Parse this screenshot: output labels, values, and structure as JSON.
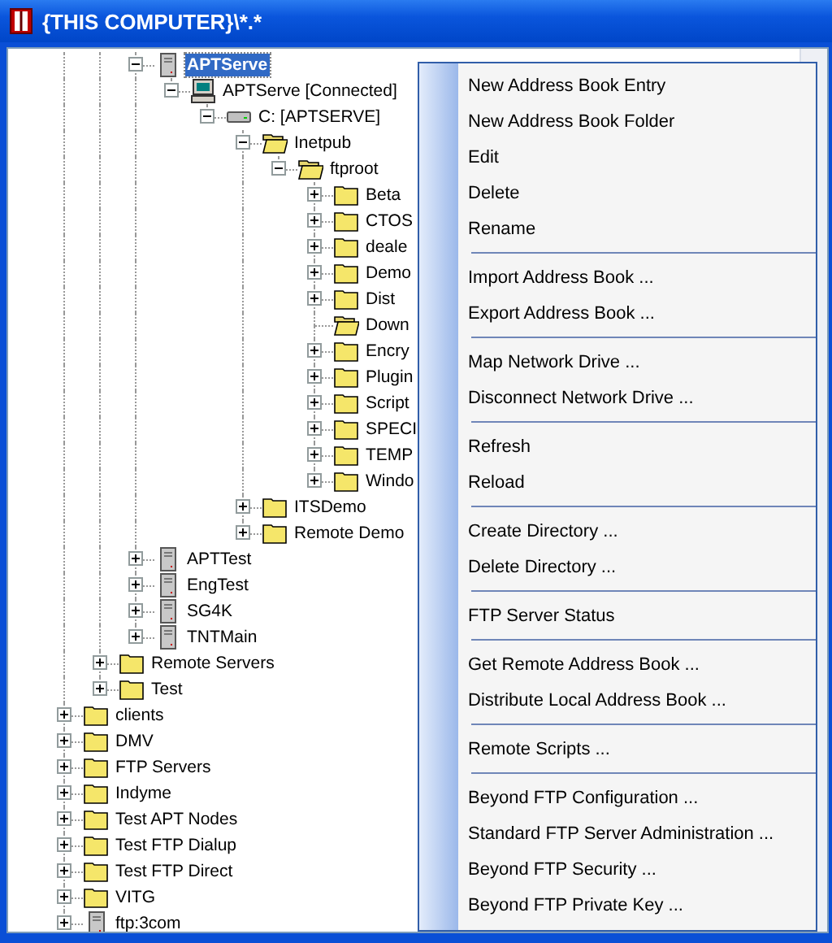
{
  "window": {
    "title": "{THIS COMPUTER}\\*.*"
  },
  "tree": {
    "children": [
      {
        "children": [
          {
            "children": [
              {
                "label": "APTServe",
                "kind": "server",
                "expandable": true,
                "expanded": true,
                "selected": true,
                "children": [
                  {
                    "label": "APTServe [Connected]",
                    "kind": "computer",
                    "expandable": true,
                    "expanded": true,
                    "selected": false,
                    "children": [
                      {
                        "label": "C: [APTSERVE]",
                        "kind": "drive",
                        "expandable": true,
                        "expanded": true,
                        "selected": false,
                        "children": [
                          {
                            "label": "Inetpub",
                            "kind": "folder",
                            "expandable": true,
                            "expanded": true,
                            "selected": false,
                            "children": [
                              {
                                "label": "ftproot",
                                "kind": "folder",
                                "expandable": true,
                                "expanded": true,
                                "selected": false,
                                "children": [
                                  {
                                    "label": "Beta",
                                    "kind": "folder",
                                    "expandable": true,
                                    "expanded": false,
                                    "selected": false
                                  },
                                  {
                                    "label": "CTOS",
                                    "kind": "folder",
                                    "expandable": true,
                                    "expanded": false,
                                    "selected": false
                                  },
                                  {
                                    "label": "deale",
                                    "kind": "folder",
                                    "expandable": true,
                                    "expanded": false,
                                    "selected": false
                                  },
                                  {
                                    "label": "Demo",
                                    "kind": "folder",
                                    "expandable": true,
                                    "expanded": false,
                                    "selected": false
                                  },
                                  {
                                    "label": "Dist",
                                    "kind": "folder",
                                    "expandable": true,
                                    "expanded": false,
                                    "selected": false
                                  },
                                  {
                                    "label": "Down",
                                    "kind": "open_folder",
                                    "expandable": false,
                                    "selected": false
                                  },
                                  {
                                    "label": "Encry",
                                    "kind": "folder",
                                    "expandable": true,
                                    "expanded": false,
                                    "selected": false
                                  },
                                  {
                                    "label": "Plugin",
                                    "kind": "folder",
                                    "expandable": true,
                                    "expanded": false,
                                    "selected": false
                                  },
                                  {
                                    "label": "Script",
                                    "kind": "folder",
                                    "expandable": true,
                                    "expanded": false,
                                    "selected": false
                                  },
                                  {
                                    "label": "SPECI",
                                    "kind": "folder",
                                    "expandable": true,
                                    "expanded": false,
                                    "selected": false
                                  },
                                  {
                                    "label": "TEMP",
                                    "kind": "folder",
                                    "expandable": true,
                                    "expanded": false,
                                    "selected": false
                                  },
                                  {
                                    "label": "Windo",
                                    "kind": "folder",
                                    "expandable": true,
                                    "expanded": false,
                                    "selected": false
                                  }
                                ]
                              }
                            ]
                          },
                          {
                            "label": "ITSDemo",
                            "kind": "folder",
                            "expandable": true,
                            "expanded": false,
                            "selected": false
                          },
                          {
                            "label": "Remote Demo",
                            "kind": "folder",
                            "expandable": true,
                            "expanded": false,
                            "selected": false
                          }
                        ]
                      }
                    ]
                  }
                ]
              },
              {
                "label": "APTTest",
                "kind": "server",
                "expandable": true,
                "expanded": false,
                "selected": false
              },
              {
                "label": "EngTest",
                "kind": "server",
                "expandable": true,
                "expanded": false,
                "selected": false
              },
              {
                "label": "SG4K",
                "kind": "server",
                "expandable": true,
                "expanded": false,
                "selected": false
              },
              {
                "label": "TNTMain",
                "kind": "server",
                "expandable": true,
                "expanded": false,
                "selected": false
              }
            ]
          },
          {
            "label": "Remote Servers",
            "kind": "folder",
            "expandable": true,
            "expanded": false,
            "selected": false
          },
          {
            "label": "Test",
            "kind": "folder",
            "expandable": true,
            "expanded": false,
            "selected": false
          }
        ]
      },
      {
        "label": "clients",
        "kind": "folder",
        "expandable": true,
        "expanded": false,
        "selected": false
      },
      {
        "label": "DMV",
        "kind": "folder",
        "expandable": true,
        "expanded": false,
        "selected": false
      },
      {
        "label": "FTP Servers",
        "kind": "folder",
        "expandable": true,
        "expanded": false,
        "selected": false
      },
      {
        "label": "Indyme",
        "kind": "folder",
        "expandable": true,
        "expanded": false,
        "selected": false
      },
      {
        "label": "Test APT Nodes",
        "kind": "folder",
        "expandable": true,
        "expanded": false,
        "selected": false
      },
      {
        "label": "Test FTP Dialup",
        "kind": "folder",
        "expandable": true,
        "expanded": false,
        "selected": false
      },
      {
        "label": "Test FTP Direct",
        "kind": "folder",
        "expandable": true,
        "expanded": false,
        "selected": false
      },
      {
        "label": "VITG",
        "kind": "folder",
        "expandable": true,
        "expanded": false,
        "selected": false
      },
      {
        "label": "ftp:3com",
        "kind": "server",
        "expandable": true,
        "expanded": false,
        "selected": false
      }
    ]
  },
  "context_menu": {
    "groups": [
      {
        "items": [
          {
            "label": "New Address Book Entry"
          },
          {
            "label": "New Address Book Folder"
          },
          {
            "label": "Edit"
          },
          {
            "label": "Delete"
          },
          {
            "label": "Rename"
          }
        ]
      },
      {
        "items": [
          {
            "label": "Import Address Book ..."
          },
          {
            "label": "Export Address Book ..."
          }
        ]
      },
      {
        "items": [
          {
            "label": "Map Network Drive ..."
          },
          {
            "label": "Disconnect Network Drive ..."
          }
        ]
      },
      {
        "items": [
          {
            "label": "Refresh"
          },
          {
            "label": "Reload"
          }
        ]
      },
      {
        "items": [
          {
            "label": "Create Directory ..."
          },
          {
            "label": "Delete Directory ..."
          }
        ]
      },
      {
        "items": [
          {
            "label": "FTP Server Status"
          }
        ]
      },
      {
        "items": [
          {
            "label": "Get Remote Address Book ..."
          },
          {
            "label": "Distribute Local Address Book ..."
          }
        ]
      },
      {
        "items": [
          {
            "label": "Remote Scripts ..."
          }
        ]
      },
      {
        "items": [
          {
            "label": "Beyond FTP Configuration ..."
          },
          {
            "label": "Standard FTP Server Administration ..."
          },
          {
            "label": "Beyond FTP Security ..."
          },
          {
            "label": "Beyond FTP Private Key ..."
          }
        ]
      }
    ]
  }
}
